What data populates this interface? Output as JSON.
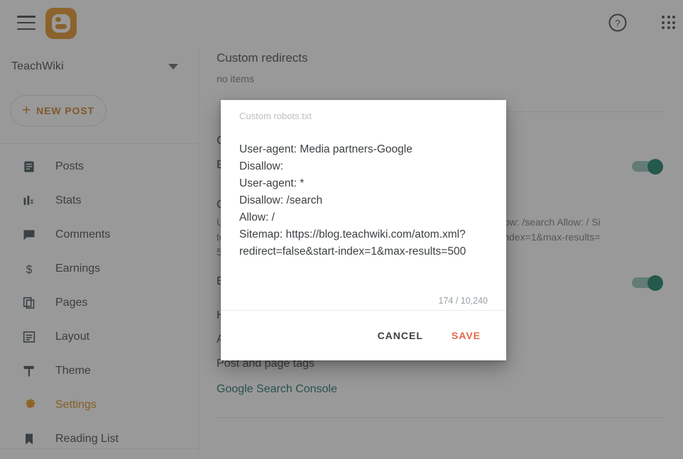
{
  "topbar": {
    "menu_icon": "hamburger-menu-icon",
    "logo_icon": "blogger-logo-icon",
    "help_icon": "help-circle-icon",
    "apps_icon": "apps-grid-icon",
    "accent_orange": "#e08b1c"
  },
  "sidebar": {
    "blog_name": "TeachWiki",
    "picker_icon": "chevron-down-icon",
    "new_post_label": "NEW POST",
    "new_post_icon": "plus-icon",
    "items": [
      {
        "label": "Posts",
        "icon": "posts-icon",
        "active": false
      },
      {
        "label": "Stats",
        "icon": "stats-bar-chart-icon",
        "active": false
      },
      {
        "label": "Comments",
        "icon": "comment-bubble-icon",
        "active": false
      },
      {
        "label": "Earnings",
        "icon": "dollar-sign-icon",
        "active": false
      },
      {
        "label": "Pages",
        "icon": "pages-copy-icon",
        "active": false
      },
      {
        "label": "Layout",
        "icon": "layout-icon",
        "active": false
      },
      {
        "label": "Theme",
        "icon": "theme-paint-roller-icon",
        "active": false
      },
      {
        "label": "Settings",
        "icon": "gear-icon",
        "active": true
      },
      {
        "label": "Reading List",
        "icon": "bookmark-icon",
        "active": false
      }
    ]
  },
  "main": {
    "custom_redirects_title": "Custom redirects",
    "custom_redirects_value": "no items",
    "crawlers_title": "Crawlers and indexing",
    "rows": [
      {
        "label": "Enable custom robots.txt",
        "value": "",
        "toggle": true,
        "toggle_on": true
      },
      {
        "label": "Custom robots.txt",
        "value": "User-agent: Media partners-Google Disallow: User-agent: * Disallow: /search Allow: / Sitemap: https://blog.teachwiki.com/atom.xml?redirect=false&start-index=1&max-results=500",
        "toggle": false,
        "toggle_on": false
      },
      {
        "label": "Enable custom robots header tags",
        "value": "",
        "toggle": true,
        "toggle_on": true
      },
      {
        "label": "Home page tags",
        "value": "",
        "toggle": false,
        "toggle_on": false
      },
      {
        "label": "Archive and search page tags",
        "value": "",
        "toggle": false,
        "toggle_on": false
      },
      {
        "label": "Post and page tags",
        "value": "",
        "toggle": false,
        "toggle_on": false
      }
    ],
    "google_search_console_label": "Google Search Console",
    "toggle_color": "#0b7a5f",
    "link_color": "#16695b"
  },
  "dialog": {
    "field_label": "Custom robots.txt",
    "textarea_value": "User-agent: Media partners-Google\nDisallow:\nUser-agent: *\nDisallow: /search\nAllow: /\nSitemap: https://blog.teachwiki.com/atom.xml?redirect=false&start-index=1&max-results=500",
    "counter": "174 / 10,240",
    "cancel_label": "CANCEL",
    "save_label": "SAVE",
    "save_color": "#e8684a"
  }
}
